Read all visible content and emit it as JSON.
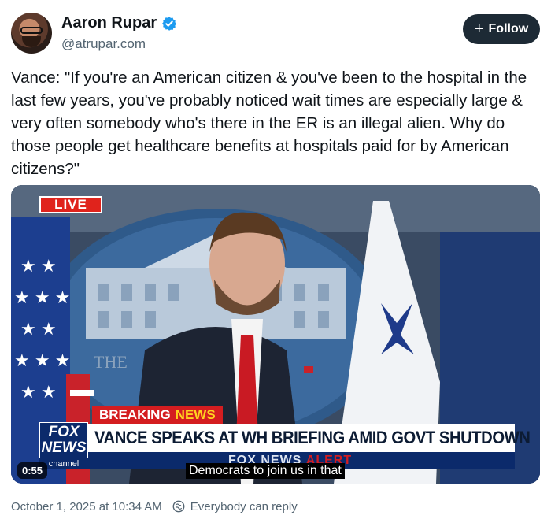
{
  "author": {
    "name": "Aaron Rupar",
    "handle": "@atrupar.com",
    "verified_icon": "verified-badge-icon",
    "avatar_icon": "avatar"
  },
  "follow_button": {
    "plus": "+",
    "label": "Follow"
  },
  "post": {
    "text": "Vance: \"If you're an American citizen & you've been to the hospital in the last few years, you've probably noticed wait times are especially large & very often somebody who's there in the ER is an illegal alien. Why do those people get healthcare benefits at hospitals paid for by American citizens?\""
  },
  "video": {
    "live_label": "LIVE",
    "breaking_label": "BREAKING",
    "breaking_news_label": "NEWS",
    "headline": "VANCE SPEAKS AT WH BRIEFING AMID GOVT SHUTDOWN",
    "logo_line1": "FOX",
    "logo_line2": "NEWS",
    "channel_label": "channel",
    "alert_text_part1": "FOX NEWS",
    "alert_text_part2": "ALERT",
    "backdrop_text": "THE",
    "caption": "Democrats to join us in that",
    "timecode": "0:55"
  },
  "footer": {
    "timestamp": "October 1, 2025 at 10:34 AM",
    "reply_setting": "Everybody can reply",
    "reply_icon": "globe-reply-icon"
  },
  "colors": {
    "follow_bg": "#1d2a35",
    "verified_blue": "#1d9bf0",
    "breaking_red": "#d41d20",
    "fox_blue": "#0b2a6b",
    "muted_text": "#536471"
  }
}
